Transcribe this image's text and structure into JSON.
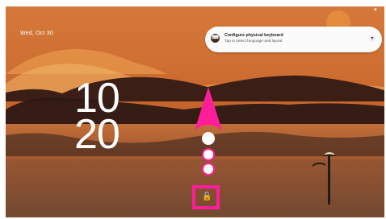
{
  "lockscreen": {
    "date": "Wed, Oct 30",
    "clock": {
      "hour": "10",
      "minute": "20"
    }
  },
  "notification": {
    "app_icon": "keyboard-icon",
    "title": "Configure physical keyboard",
    "text": "Tap to select language and layout",
    "expand_icon": "chevron-down-icon"
  },
  "unlock": {
    "icon": "unlock-icon",
    "hint_arrow_color": "#ff1e99"
  },
  "colors": {
    "accent": "#ff1e99",
    "sky": "#d5793a",
    "ground": "#7a4a2c"
  }
}
